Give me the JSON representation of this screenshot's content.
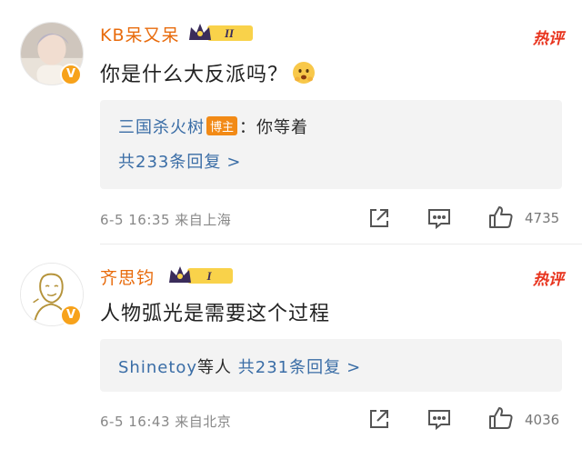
{
  "comments": [
    {
      "username": "KB呆又呆",
      "level_badge": "II",
      "hot_label": "热评",
      "text": "你是什么大反派吗？",
      "emoji": "shocked-face-emoji",
      "reply_preview": {
        "author": "三国杀火树",
        "host_badge": "博主",
        "separator": "：",
        "text": "你等着",
        "total_link": "共233条回复",
        "chevron": ">"
      },
      "meta": "6-5 16:35 来自上海",
      "like_count": "4735"
    },
    {
      "username": "齐思钧",
      "level_badge": "I",
      "hot_label": "热评",
      "text": "人物弧光是需要这个过程",
      "reply_preview": {
        "author": "Shinetoy",
        "author_suffix": "等人",
        "total_link": "共231条回复",
        "chevron": ">"
      },
      "meta": "6-5 16:43 来自北京",
      "like_count": "4036"
    }
  ],
  "verified_badge_glyph": "V",
  "colors": {
    "username": "#e86b0c",
    "hot_label": "#e8331d",
    "link": "#3a6da6",
    "host_badge": "#f28a16",
    "verified_badge": "#f7a21b",
    "reply_bg": "#f3f3f3"
  },
  "icons": [
    "crown-badge-icon",
    "share-icon",
    "comment-icon",
    "like-icon",
    "verified-v-icon"
  ]
}
